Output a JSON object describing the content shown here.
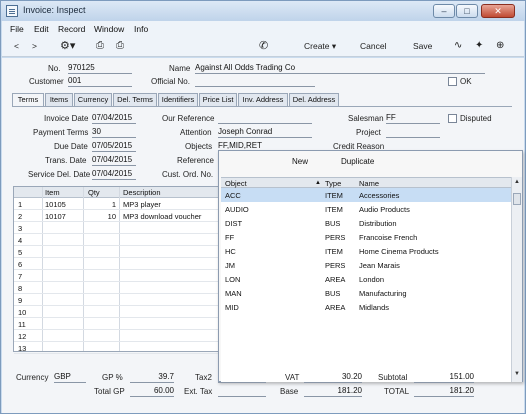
{
  "window": {
    "title": "Invoice: Inspect"
  },
  "menu": [
    "File",
    "Edit",
    "Record",
    "Window",
    "Info"
  ],
  "toolbar": {
    "create": "Create",
    "cancel": "Cancel",
    "save": "Save"
  },
  "header": {
    "no_label": "No.",
    "no_value": "970125",
    "name_label": "Name",
    "name_value": "Against All Odds Trading Co",
    "customer_label": "Customer",
    "customer_value": "001",
    "official_no_label": "Official No.",
    "official_no_value": "",
    "ok_label": "OK"
  },
  "tabs": [
    "Terms",
    "Items",
    "Currency",
    "Del. Terms",
    "Identifiers",
    "Price List",
    "Inv. Address",
    "Del. Address"
  ],
  "terms": {
    "invoice_date_label": "Invoice Date",
    "invoice_date": "07/04/2015",
    "our_reference_label": "Our Reference",
    "our_reference": "",
    "salesman_label": "Salesman",
    "salesman": "FF",
    "disputed_label": "Disputed",
    "payment_terms_label": "Payment Terms",
    "payment_terms": "30",
    "attention_label": "Attention",
    "attention": "Joseph Conrad",
    "project_label": "Project",
    "project": "",
    "due_date_label": "Due Date",
    "due_date": "07/05/2015",
    "objects_label": "Objects",
    "objects": "FF,MID,RET",
    "credit_reason_label": "Credit Reason",
    "trans_date_label": "Trans. Date",
    "trans_date": "07/04/2015",
    "reference_label": "Reference",
    "service_del_date_label": "Service Del. Date",
    "service_del_date": "07/04/2015",
    "cust_ord_no_label": "Cust. Ord. No."
  },
  "grid": {
    "headers": {
      "item": "Item",
      "qty": "Qty",
      "description": "Description"
    },
    "rows": [
      {
        "n": "1",
        "item": "10105",
        "qty": "1",
        "desc": "MP3 player"
      },
      {
        "n": "2",
        "item": "10107",
        "qty": "10",
        "desc": "MP3 download voucher"
      },
      {
        "n": "3"
      },
      {
        "n": "4"
      },
      {
        "n": "5"
      },
      {
        "n": "6"
      },
      {
        "n": "7"
      },
      {
        "n": "8"
      },
      {
        "n": "9"
      },
      {
        "n": "10"
      },
      {
        "n": "11"
      },
      {
        "n": "12"
      },
      {
        "n": "13"
      }
    ]
  },
  "popup": {
    "new": "New",
    "duplicate": "Duplicate",
    "headers": {
      "object": "Object",
      "type": "Type",
      "name": "Name"
    },
    "rows": [
      {
        "object": "ACC",
        "type": "ITEM",
        "name": "Accessories"
      },
      {
        "object": "AUDIO",
        "type": "ITEM",
        "name": "Audio Products"
      },
      {
        "object": "DIST",
        "type": "BUS",
        "name": "Distribution"
      },
      {
        "object": "FF",
        "type": "PERS",
        "name": "Francoise French"
      },
      {
        "object": "HC",
        "type": "ITEM",
        "name": "Home Cinema Products"
      },
      {
        "object": "JM",
        "type": "PERS",
        "name": "Jean Marais"
      },
      {
        "object": "LON",
        "type": "AREA",
        "name": "London"
      },
      {
        "object": "MAN",
        "type": "BUS",
        "name": "Manufacturing"
      },
      {
        "object": "MID",
        "type": "AREA",
        "name": "Midlands"
      }
    ]
  },
  "footer": {
    "currency_label": "Currency",
    "currency": "GBP",
    "gp_pct_label": "GP %",
    "gp_pct": "39.7",
    "tax2_label": "Tax2",
    "tax2": "",
    "vat_label": "VAT",
    "vat": "30.20",
    "subtotal_label": "Subtotal",
    "subtotal": "151.00",
    "total_gp_label": "Total GP",
    "total_gp": "60.00",
    "ext_tax_label": "Ext. Tax",
    "ext_tax": "",
    "base_label": "Base",
    "base": "181.20",
    "total_label": "TOTAL",
    "total": "181.20"
  }
}
